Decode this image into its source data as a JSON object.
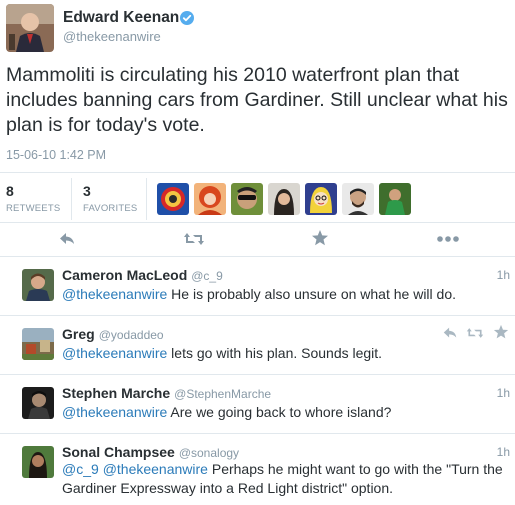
{
  "tweet": {
    "author_name": "Edward Keenan",
    "author_handle": "@thekeenanwire",
    "text": "Mammoliti is circulating his 2010 waterfront plan that includes banning cars from Gardiner. Still unclear what his plan is for today's vote.",
    "timestamp": "15-06-10 1:42 PM",
    "retweets_count": "8",
    "retweets_label": "RETWEETS",
    "favorites_count": "3",
    "favorites_label": "FAVORITES",
    "favoriter_avatars": [
      "avatar-red-circle",
      "avatar-redhead",
      "avatar-sunglasses",
      "avatar-dark-hair",
      "avatar-cartoon-blonde",
      "avatar-bearded-man",
      "avatar-green-figure"
    ]
  },
  "actions": {
    "icons": [
      "reply-icon",
      "retweet-icon",
      "favorite-icon",
      "more-icon"
    ]
  },
  "colors": {
    "link": "#2b7bb9",
    "verified": "#55acee",
    "muted": "#8899a6",
    "text": "#292f33",
    "divider": "#e1e8ed"
  },
  "replies": [
    {
      "name": "Cameron MacLeod",
      "handle": "@c_9",
      "time": "1h",
      "mentions": [
        "@thekeenanwire"
      ],
      "text": " He is probably also unsure on what he will do."
    },
    {
      "name": "Greg",
      "handle": "@yodaddeo",
      "time": "",
      "mentions": [
        "@thekeenanwire"
      ],
      "text": " lets go with his plan. Sounds legit."
    },
    {
      "name": "Stephen Marche",
      "handle": "@StephenMarche",
      "time": "1h",
      "mentions": [
        "@thekeenanwire"
      ],
      "text": " Are we going back to whore island?"
    },
    {
      "name": "Sonal Champsee",
      "handle": "@sonalogy",
      "time": "1h",
      "mentions": [
        "@c_9",
        "@thekeenanwire"
      ],
      "text": " Perhaps he might want to go with the \"Turn the Gardiner Expressway into a Red Light district\" option."
    }
  ]
}
